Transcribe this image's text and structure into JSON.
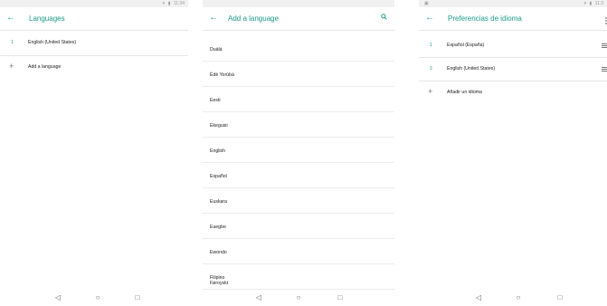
{
  "screens": [
    {
      "status": {
        "time": "11:34"
      },
      "title": "Languages",
      "languages": [
        {
          "num": "1",
          "name": "English (United States)"
        }
      ],
      "add_label": "Add a language"
    },
    {
      "title": "Add a language",
      "list": [
        "Duálá",
        "Èdè Yorùbá",
        "Eesti",
        "Ekegusii",
        "English",
        "Español",
        "Euskara",
        "Eʋegbe",
        "Ewondo",
        "Filipino",
        "Føroyskt"
      ]
    },
    {
      "status": {
        "time": "11:3"
      },
      "title": "Preferencias de idioma",
      "languages": [
        {
          "num": "1",
          "name": "Español (España)"
        },
        {
          "num": "2",
          "name": "English (United States)"
        }
      ],
      "add_label": "Añadir un idioma"
    }
  ],
  "icons": {
    "back": "arrow-back-icon",
    "search": "search-icon",
    "drag": "drag-handle-icon",
    "add": "plus-icon",
    "nav_back": "triangle-back-icon",
    "nav_home": "circle-home-icon",
    "nav_recents": "square-recents-icon"
  },
  "colors": {
    "accent": "#1a9a8a",
    "divider": "#e6e6e6",
    "statusbar": "#f1f1f1"
  }
}
